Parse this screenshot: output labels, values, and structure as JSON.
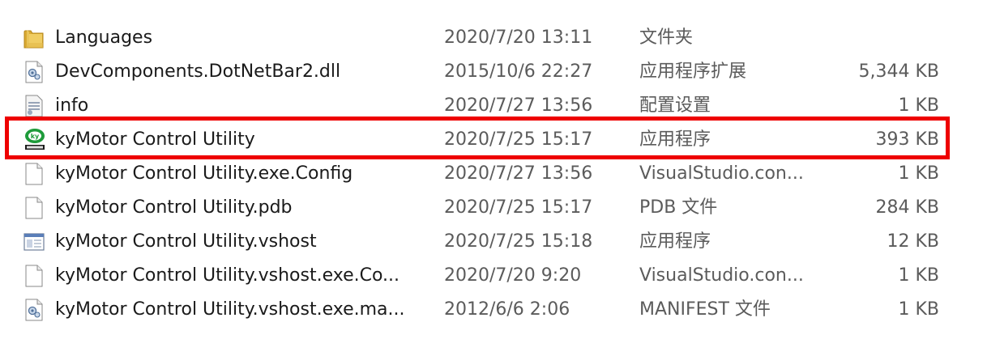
{
  "files": [
    {
      "name": "Languages",
      "date": "2020/7/20 13:11",
      "type": "文件夹",
      "size": "",
      "icon": "folder-icon"
    },
    {
      "name": "DevComponents.DotNetBar2.dll",
      "date": "2015/10/6 22:27",
      "type": "应用程序扩展",
      "size": "5,344 KB",
      "icon": "dll-file-icon"
    },
    {
      "name": "info",
      "date": "2020/7/27 13:56",
      "type": "配置设置",
      "size": "1 KB",
      "icon": "settings-file-icon"
    },
    {
      "name": "kyMotor Control Utility",
      "date": "2020/7/25 15:17",
      "type": "应用程序",
      "size": "393 KB",
      "icon": "app-exe-icon"
    },
    {
      "name": "kyMotor Control Utility.exe.Config",
      "date": "2020/7/27 13:56",
      "type": "VisualStudio.con...",
      "size": "1 KB",
      "icon": "blank-file-icon"
    },
    {
      "name": "kyMotor Control Utility.pdb",
      "date": "2020/7/25 15:17",
      "type": "PDB 文件",
      "size": "284 KB",
      "icon": "blank-file-icon"
    },
    {
      "name": "kyMotor Control Utility.vshost",
      "date": "2020/7/25 15:18",
      "type": "应用程序",
      "size": "12 KB",
      "icon": "window-app-icon"
    },
    {
      "name": "kyMotor Control Utility.vshost.exe.Co...",
      "date": "2020/7/20 9:20",
      "type": "VisualStudio.con...",
      "size": "1 KB",
      "icon": "blank-file-icon"
    },
    {
      "name": "kyMotor Control Utility.vshost.exe.ma...",
      "date": "2012/6/6 2:06",
      "type": "MANIFEST 文件",
      "size": "1 KB",
      "icon": "manifest-file-icon"
    }
  ],
  "highlight_color": "#ee0000"
}
